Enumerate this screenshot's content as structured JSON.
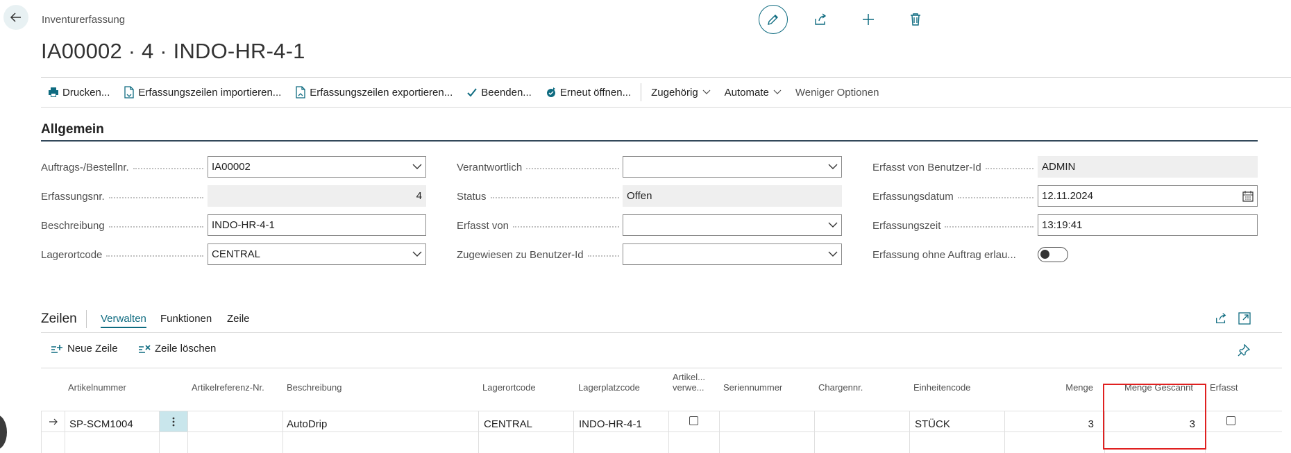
{
  "header": {
    "breadcrumb": "Inventurerfassung",
    "title": "IA00002 · 4 · INDO-HR-4-1"
  },
  "actions": {
    "print": "Drucken...",
    "import_lines": "Erfassungszeilen importieren...",
    "export_lines": "Erfassungszeilen exportieren...",
    "finish": "Beenden...",
    "reopen": "Erneut öffnen...",
    "related": "Zugehörig",
    "automate": "Automate",
    "fewer_options": "Weniger Optionen"
  },
  "general": {
    "title": "Allgemein",
    "order_no_label": "Auftrags-/Bestellnr.",
    "order_no_value": "IA00002",
    "recording_no_label": "Erfassungsnr.",
    "recording_no_value": "4",
    "description_label": "Beschreibung",
    "description_value": "INDO-HR-4-1",
    "location_label": "Lagerortcode",
    "location_value": "CENTRAL",
    "responsible_label": "Verantwortlich",
    "responsible_value": "",
    "status_label": "Status",
    "status_value": "Offen",
    "recorded_by_label": "Erfasst von",
    "recorded_by_value": "",
    "assigned_user_label": "Zugewiesen zu Benutzer-Id",
    "assigned_user_value": "",
    "recorded_by_user_label": "Erfasst von Benutzer-Id",
    "recorded_by_user_value": "ADMIN",
    "date_label": "Erfassungsdatum",
    "date_value": "12.11.2024",
    "time_label": "Erfassungszeit",
    "time_value": "13:19:41",
    "without_order_label": "Erfassung ohne Auftrag erlau...",
    "without_order_on": false
  },
  "lines": {
    "title": "Zeilen",
    "tabs": [
      "Verwalten",
      "Funktionen",
      "Zeile"
    ],
    "new_line": "Neue Zeile",
    "delete_line": "Zeile löschen",
    "columns": {
      "item_no": "Artikelnummer",
      "item_ref": "Artikelreferenz-Nr.",
      "description": "Beschreibung",
      "location": "Lagerortcode",
      "bin": "Lagerplatzcode",
      "item_tracked_1": "Artikel...",
      "item_tracked_2": "verwe...",
      "serial": "Seriennummer",
      "lot": "Chargennr.",
      "uom": "Einheitencode",
      "qty": "Menge",
      "qty_scanned": "Menge Gescannt",
      "recorded": "Erfasst"
    },
    "rows": [
      {
        "item_no": "SP-SCM1004",
        "item_ref": "",
        "description": "AutoDrip",
        "location": "CENTRAL",
        "bin": "INDO-HR-4-1",
        "item_tracked": false,
        "serial": "",
        "lot": "",
        "uom": "STÜCK",
        "qty": "3",
        "qty_scanned": "3",
        "recorded": false
      }
    ]
  },
  "colors": {
    "accent": "#0e6b80",
    "highlight": "#e02020",
    "section_rule": "#32485a"
  }
}
